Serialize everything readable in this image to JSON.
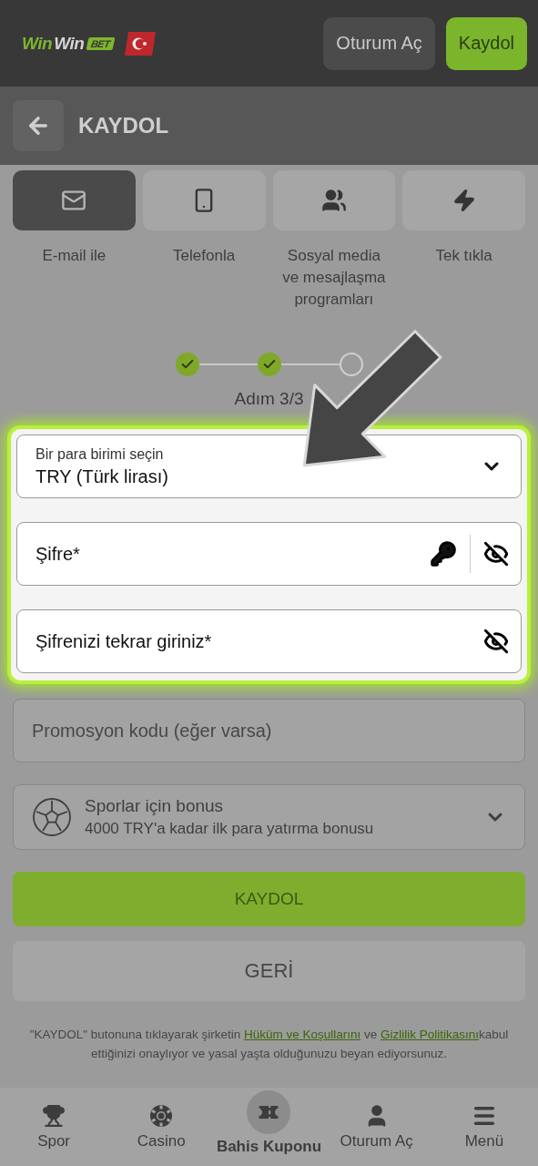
{
  "header": {
    "logo": {
      "part_1": "Win",
      "part_2": "Win",
      "badge": "BET"
    },
    "buttons": [
      {
        "label": "Oturum Aç",
        "kind": "secondary"
      },
      {
        "label": "Kaydol",
        "kind": "primary"
      }
    ]
  },
  "page_title": "KAYDOL",
  "methods": [
    {
      "label": "E-mail ile",
      "kind": "email",
      "selected": true
    },
    {
      "label": "Telefonla",
      "kind": "phone",
      "selected": false
    },
    {
      "label": "Sosyal media ve mesajlaşma programları",
      "kind": "social",
      "selected": false
    },
    {
      "label": "Tek tıkla",
      "kind": "quick",
      "selected": false
    }
  ],
  "stepper": {
    "steps": [
      {
        "done": true
      },
      {
        "done": true
      },
      {
        "done": false
      }
    ],
    "label": "Adım 3/3"
  },
  "currency": {
    "label": "Bir para birimi seçin",
    "value": "TRY",
    "note": "(Türk lirası)"
  },
  "password": {
    "placeholder": "Şifre*"
  },
  "password_repeat": {
    "placeholder": "Şifrenizi tekrar giriniz*"
  },
  "promo": {
    "placeholder": "Promosyon kodu (eğer varsa)"
  },
  "bonus": {
    "title": "Sporlar için bonus",
    "subtitle": "4000 TRY'a kadar ilk para yatırma bonusu"
  },
  "submit_button": "KAYDOL",
  "back_button": "GERİ",
  "disclaimer": {
    "before": "\"KAYDOL\" butonuna tıklayarak şirketin ",
    "link_1": "Hüküm ve Koşullarını",
    "middle": " ve ",
    "link_2": "Gizlilik Politikasını",
    "after": "kabul ettiğinizi onaylıyor ve yasal yaşta olduğunuzu beyan ediyorsunuz."
  },
  "nav": [
    {
      "label": "Spor",
      "kind": "sport",
      "selected": false
    },
    {
      "label": "Casino",
      "kind": "casino",
      "selected": false
    },
    {
      "label": "Bahis Kuponu",
      "kind": "coupon",
      "selected": true
    },
    {
      "label": "Oturum Aç",
      "kind": "login",
      "selected": false
    },
    {
      "label": "Menü",
      "kind": "menu",
      "selected": false
    }
  ]
}
